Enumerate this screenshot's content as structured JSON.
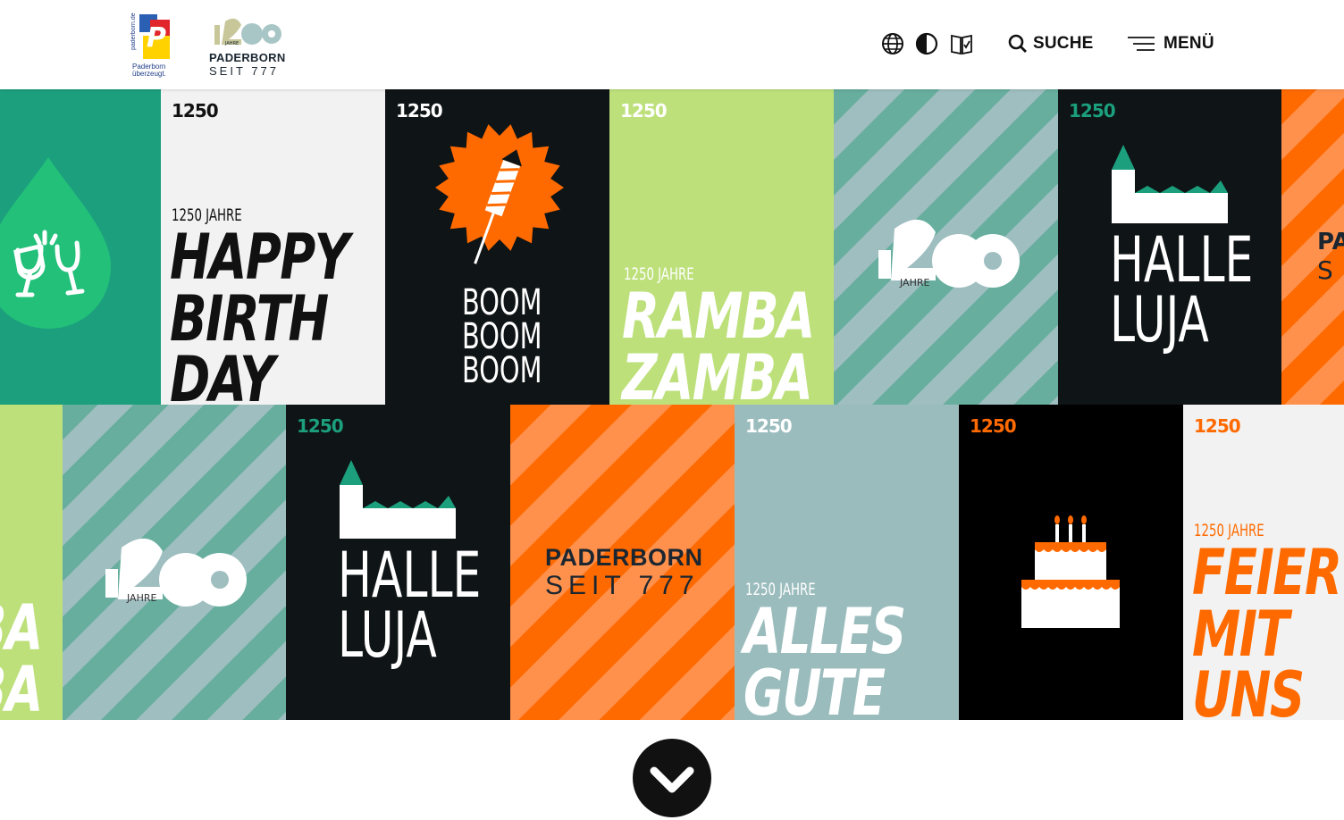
{
  "header": {
    "city_logo": {
      "side_text": "paderborn.de",
      "line1": "Paderborn",
      "line2": "überzeugt.",
      "mark_letter": "P"
    },
    "anniversary_logo": {
      "digits": "1250",
      "small": "JAHRE",
      "city": "PADERBORN",
      "since": "SEIT 777"
    },
    "icons": [
      "globe-icon",
      "contrast-icon",
      "easy-reading-icon"
    ],
    "search_label": "SUCHE",
    "menu_label": "MENÜ"
  },
  "colors": {
    "green": "#1b9f7d",
    "mint": "#23c07a",
    "light_gray": "#f2f2f2",
    "dark": "#0f1416",
    "lime": "#bde07b",
    "teal_stripe_a": "#9fbec0",
    "teal_stripe_b": "#67ae9e",
    "orange": "#ff6a00",
    "orange_light": "#ff914d",
    "slate": "#9bbcbd",
    "black": "#000000"
  },
  "tiles": {
    "birthday": {
      "mini": "1250",
      "sub": "1250 JAHRE",
      "lines": [
        "HAPPY",
        "BIRTH",
        "DAY"
      ]
    },
    "boom": {
      "mini": "1250",
      "lines": [
        "BOOM",
        "BOOM",
        "BOOM"
      ]
    },
    "ramba": {
      "mini": "1250",
      "sub": "1250 JAHRE",
      "lines": [
        "RAMBA",
        "ZAMBA"
      ]
    },
    "logo_tile": {
      "digits": "1250",
      "small": "JAHRE"
    },
    "halleluja": {
      "mini": "1250",
      "lines": [
        "HALLE",
        "LUJA"
      ]
    },
    "edge_right": {
      "lines": [
        "PA",
        "S"
      ]
    },
    "edge_left": {
      "lines": [
        "BA",
        "BA"
      ]
    },
    "paderborn": {
      "line1": "PADERBORN",
      "line2": "SEIT 777"
    },
    "alles": {
      "mini": "1250",
      "sub": "1250 JAHRE",
      "lines": [
        "ALLES",
        "GUTE"
      ]
    },
    "cake": {
      "mini": "1250"
    },
    "feier": {
      "mini": "1250",
      "sub": "1250 JAHRE",
      "lines": [
        "FEIER",
        "MIT",
        "UNS"
      ]
    }
  }
}
